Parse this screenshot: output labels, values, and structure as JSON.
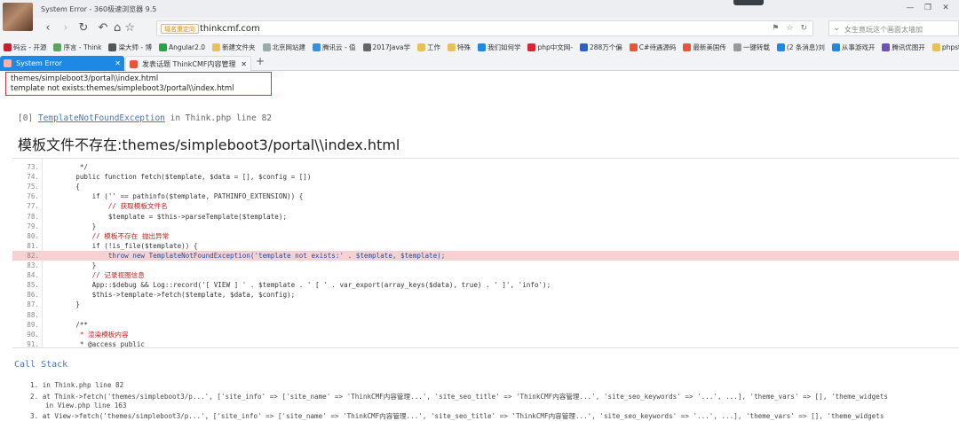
{
  "window": {
    "title": "System Error - 360极速浏览器 9.5",
    "controls": [
      "—",
      "❐",
      "✕"
    ]
  },
  "nav": {
    "back": "‹",
    "forward": "›",
    "reload": "↻",
    "undo": "↶",
    "star": "☆"
  },
  "address": {
    "tag": "域名重定向",
    "url": "thinkcmf.com",
    "icons": [
      "⚑",
      "☆",
      "↻"
    ]
  },
  "search": {
    "placeholder": "女生竟玩这个画面太墙加"
  },
  "bookmarks": [
    {
      "label": "码云 - 开源",
      "color": "#c7202e"
    },
    {
      "label": "序言 - Think",
      "color": "#5da35d"
    },
    {
      "label": "梁大师 - 博",
      "color": "#555"
    },
    {
      "label": "Angular2.0",
      "color": "#2aa24a"
    },
    {
      "label": "新建文件夹",
      "color": "#e8c159"
    },
    {
      "label": "北京网站建",
      "color": "#9aa"
    },
    {
      "label": "腾讯云 - 值",
      "color": "#3b8ed8"
    },
    {
      "label": "2017Java学",
      "color": "#666"
    },
    {
      "label": "工作",
      "color": "#e8c159"
    },
    {
      "label": "特殊",
      "color": "#e8c159"
    },
    {
      "label": "我们如何学",
      "color": "#1e88e5"
    },
    {
      "label": "php中文网-",
      "color": "#d23"
    },
    {
      "label": "288万个偏",
      "color": "#2a5fcc"
    },
    {
      "label": "C#待遇源码",
      "color": "#e8533c"
    },
    {
      "label": "最新美国传",
      "color": "#e8533c"
    },
    {
      "label": "一键转载",
      "color": "#999"
    },
    {
      "label": "(2 条消息)刘",
      "color": "#1e88e5"
    },
    {
      "label": "从事游戏开",
      "color": "#1e88e5"
    },
    {
      "label": "腾讯优图开",
      "color": "#6b4fbb"
    },
    {
      "label": "phpstor",
      "color": "#e8c159"
    }
  ],
  "tabs": [
    {
      "label": "System Error",
      "active": true
    },
    {
      "label": "发表话题 ThinkCMF内容管理",
      "active": false
    }
  ],
  "newtab": "+",
  "error_box": {
    "line1": "themes/simpleboot3/portal\\\\index.html",
    "line2": "template not exists:themes/simpleboot3/portal\\\\index.html"
  },
  "exception": {
    "index": "[0]",
    "name": "TemplateNotFoundException",
    "where": "in Think.php line 82"
  },
  "message": "模板文件不存在:themes/simpleboot3/portal\\\\index.html",
  "code": [
    {
      "n": "73.",
      "t": "     */"
    },
    {
      "n": "74.",
      "t": "    public function fetch($template, $data = [], $config = [])"
    },
    {
      "n": "75.",
      "t": "    {"
    },
    {
      "n": "76.",
      "t": "        if ('' == pathinfo($template, PATHINFO_EXTENSION)) {"
    },
    {
      "n": "77.",
      "t": "            // 获取模板文件名"
    },
    {
      "n": "78.",
      "t": "            $template = $this->parseTemplate($template);"
    },
    {
      "n": "79.",
      "t": "        }"
    },
    {
      "n": "80.",
      "t": "        // 模板不存在 抛出异常"
    },
    {
      "n": "81.",
      "t": "        if (!is_file($template)) {"
    },
    {
      "n": "82.",
      "t": "            throw new TemplateNotFoundException('template not exists:' . $template, $template);"
    },
    {
      "n": "83.",
      "t": "        }"
    },
    {
      "n": "84.",
      "t": "        // 记录视图信息"
    },
    {
      "n": "85.",
      "t": "        App::$debug && Log::record('[ VIEW ] ' . $template . ' [ ' . var_export(array_keys($data), true) . ' ]', 'info');"
    },
    {
      "n": "86.",
      "t": "        $this->template->fetch($template, $data, $config);"
    },
    {
      "n": "87.",
      "t": "    }"
    },
    {
      "n": "88.",
      "t": ""
    },
    {
      "n": "89.",
      "t": "    /**"
    },
    {
      "n": "90.",
      "t": "     * 渲染模板内容"
    },
    {
      "n": "91.",
      "t": "     * @access public"
    }
  ],
  "call_stack": {
    "heading": "Call Stack",
    "items": [
      {
        "n": "1.",
        "text": "in Think.php line 82"
      },
      {
        "n": "2.",
        "text": "at Think->fetch('themes/simpleboot3/p...', ['site_info' => ['site_name' => 'ThinkCMF内容管理...', 'site_seo_title' => 'ThinkCMF内容管理...', 'site_seo_keywords' => '...', ...], 'theme_vars' => [], 'theme_widgets"
      },
      {
        "n": "",
        "text": "in View.php line 163"
      },
      {
        "n": "3.",
        "text": "at View->fetch('themes/simpleboot3/p...', ['site_info' => ['site_name' => 'ThinkCMF内容管理...', 'site_seo_title' => 'ThinkCMF内容管理...', 'site_seo_keywords' => '...', ...], 'theme_vars' => [], 'theme_widgets"
      }
    ]
  }
}
